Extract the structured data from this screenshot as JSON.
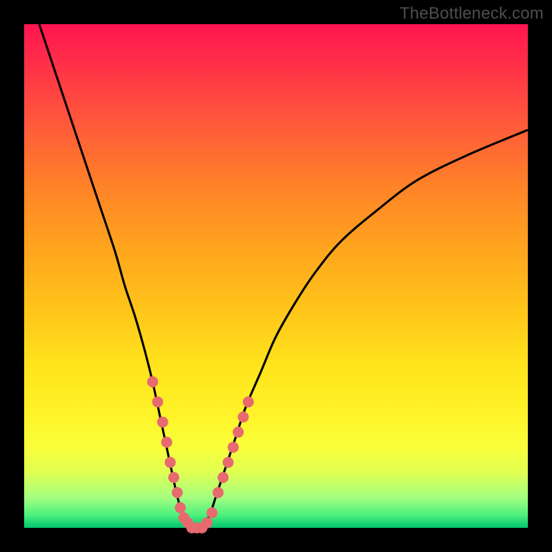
{
  "attribution": "TheBottleneck.com",
  "chart_data": {
    "type": "line",
    "title": "",
    "xlabel": "",
    "ylabel": "",
    "xlim": [
      0,
      100
    ],
    "ylim": [
      0,
      100
    ],
    "curve": {
      "name": "bottleneck-curve",
      "x": [
        3,
        6,
        9,
        12,
        15,
        18,
        20,
        22,
        24,
        25.5,
        27,
        28.5,
        30,
        31,
        32,
        33,
        34,
        35,
        36,
        37,
        38,
        40,
        42,
        44,
        47,
        50,
        54,
        58,
        63,
        70,
        78,
        88,
        100
      ],
      "y": [
        100,
        91,
        82,
        73,
        64,
        55,
        48,
        42,
        35,
        29,
        22,
        15,
        8,
        4,
        1,
        0,
        0,
        0,
        1,
        3,
        6,
        12,
        18,
        24,
        31,
        38,
        45,
        51,
        57,
        63,
        69,
        74,
        79
      ]
    },
    "markers": {
      "name": "dots",
      "x": [
        25.5,
        26.5,
        27.5,
        28.3,
        29,
        29.7,
        30.4,
        31,
        31.7,
        32.5,
        33.3,
        34.3,
        35.3,
        36.3,
        37.3,
        38.5,
        39.5,
        40.5,
        41.5,
        42.5,
        43.5,
        44.5
      ],
      "y": [
        29,
        25,
        21,
        17,
        13,
        10,
        7,
        4,
        2,
        1,
        0,
        0,
        0,
        1,
        3,
        7,
        10,
        13,
        16,
        19,
        22,
        25
      ],
      "color": "#e76a6f",
      "radius": 8
    },
    "gradient_stops": [
      {
        "pos": 0.0,
        "color": "#ff1450"
      },
      {
        "pos": 0.08,
        "color": "#ff3048"
      },
      {
        "pos": 0.2,
        "color": "#ff5a3a"
      },
      {
        "pos": 0.32,
        "color": "#ff8228"
      },
      {
        "pos": 0.44,
        "color": "#ffa31e"
      },
      {
        "pos": 0.56,
        "color": "#ffc31a"
      },
      {
        "pos": 0.68,
        "color": "#ffe41c"
      },
      {
        "pos": 0.78,
        "color": "#fff42a"
      },
      {
        "pos": 0.84,
        "color": "#f8ff3a"
      },
      {
        "pos": 0.89,
        "color": "#e0ff52"
      },
      {
        "pos": 0.94,
        "color": "#a4ff80"
      },
      {
        "pos": 0.975,
        "color": "#4cf07c"
      },
      {
        "pos": 1.0,
        "color": "#00c46e"
      }
    ]
  }
}
